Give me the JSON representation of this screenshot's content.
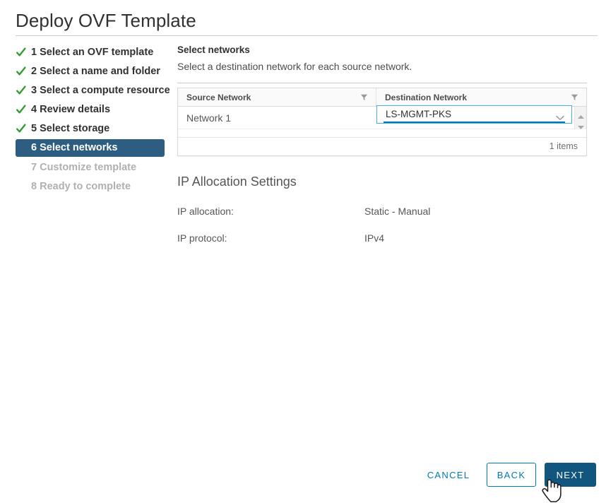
{
  "window": {
    "title": "Deploy OVF Template"
  },
  "steps": [
    {
      "number": "1",
      "label": "Select an OVF template",
      "state": "done",
      "text": "1 Select an OVF template"
    },
    {
      "number": "2",
      "label": "Select a name and folder",
      "state": "done",
      "text": "2 Select a name and folder"
    },
    {
      "number": "3",
      "label": "Select a compute resource",
      "state": "done",
      "text": "3 Select a compute resource"
    },
    {
      "number": "4",
      "label": "Review details",
      "state": "done",
      "text": "4 Review details"
    },
    {
      "number": "5",
      "label": "Select storage",
      "state": "done",
      "text": "5 Select storage"
    },
    {
      "number": "6",
      "label": "Select networks",
      "state": "active",
      "text": "6 Select networks"
    },
    {
      "number": "7",
      "label": "Customize template",
      "state": "upcoming",
      "text": "7 Customize template"
    },
    {
      "number": "8",
      "label": "Ready to complete",
      "state": "upcoming",
      "text": "8 Ready to complete"
    }
  ],
  "pane": {
    "heading": "Select networks",
    "subheading": "Select a destination network for each source network."
  },
  "network_table": {
    "columns": [
      {
        "key": "source",
        "label": "Source Network"
      },
      {
        "key": "destination",
        "label": "Destination Network"
      }
    ],
    "rows": [
      {
        "source": "Network 1",
        "destination": "LS-MGMT-PKS"
      }
    ],
    "footer_count": "1 items"
  },
  "ip_allocation": {
    "title": "IP Allocation Settings",
    "fields": [
      {
        "label": "IP allocation:",
        "value": "Static - Manual"
      },
      {
        "label": "IP protocol:",
        "value": "IPv4"
      }
    ]
  },
  "footer": {
    "cancel_label": "CANCEL",
    "back_label": "BACK",
    "next_label": "NEXT"
  },
  "colors": {
    "accent_blue": "#0079b8",
    "primary_button": "#11567f",
    "active_step": "#2d5d81",
    "check_green": "#2d9c2d",
    "focus_border": "#49afd9",
    "text_primary": "#313131",
    "text_secondary": "#565656",
    "text_muted": "#b0b0b0",
    "border": "#d9d9d9"
  }
}
